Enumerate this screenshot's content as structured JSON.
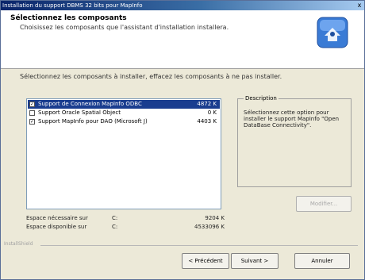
{
  "window": {
    "title": "Installation du support DBMS 32 bits pour MapInfo",
    "close_glyph": "x"
  },
  "header": {
    "title": "Sélectionnez les composants",
    "subtitle": "Choisissez les composants que l'assistant d'installation installera.",
    "icon": "install-wizard-icon"
  },
  "instruction": "Sélectionnez les composants à installer, effacez les composants à ne pas installer.",
  "components": [
    {
      "label": "Support de Connexion MapInfo ODBC",
      "size": "4872 K",
      "checked": true,
      "selected": true
    },
    {
      "label": "Support Oracle Spatial Object",
      "size": "0 K",
      "checked": false,
      "selected": false
    },
    {
      "label": "Support MapInfo pour DAO (Microsoft J)",
      "size": "4403 K",
      "checked": true,
      "selected": false
    }
  ],
  "description": {
    "legend": "Description",
    "text": "Sélectionnez cette option pour installer le support MapInfo \"Open DataBase Connectivity\"."
  },
  "change_button": "Modifier...",
  "space": {
    "required_label": "Espace nécessaire sur",
    "required_drive": "C:",
    "required_value": "9204 K",
    "available_label": "Espace disponible sur",
    "available_drive": "C:",
    "available_value": "4533096 K"
  },
  "brand": "InstallShield",
  "buttons": {
    "back": "< Précédent",
    "next": "Suivant >",
    "cancel": "Annuler"
  },
  "colors": {
    "title_bar": "#0a246a",
    "selection": "#1a3d8f"
  }
}
